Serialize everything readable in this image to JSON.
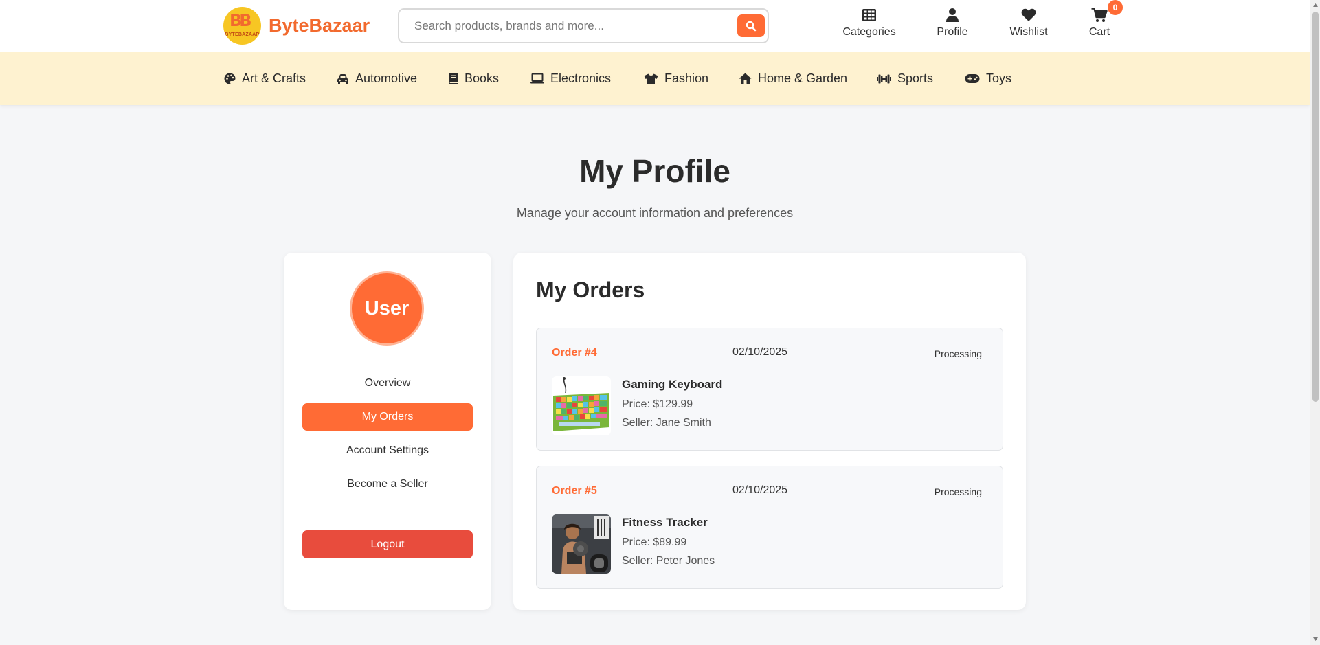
{
  "brand": {
    "name": "ByteBazaar",
    "logo_letters": "BB",
    "logo_small": "BYTEBAZAAR"
  },
  "search": {
    "placeholder": "Search products, brands and more...",
    "value": ""
  },
  "nav": {
    "categories": "Categories",
    "profile": "Profile",
    "wishlist": "Wishlist",
    "cart": "Cart",
    "cart_count": "0"
  },
  "category_bar": [
    {
      "label": "Art & Crafts",
      "icon": "palette-icon"
    },
    {
      "label": "Automotive",
      "icon": "car-icon"
    },
    {
      "label": "Books",
      "icon": "book-icon"
    },
    {
      "label": "Electronics",
      "icon": "laptop-icon"
    },
    {
      "label": "Fashion",
      "icon": "shirt-icon"
    },
    {
      "label": "Home & Garden",
      "icon": "home-icon"
    },
    {
      "label": "Sports",
      "icon": "dumbbell-icon"
    },
    {
      "label": "Toys",
      "icon": "gamepad-icon"
    }
  ],
  "page": {
    "title": "My Profile",
    "subtitle": "Manage your account information and preferences"
  },
  "sidebar": {
    "avatar_text": "User",
    "links": [
      "Overview",
      "My Orders",
      "Account Settings",
      "Become a Seller"
    ],
    "active": "My Orders",
    "logout": "Logout"
  },
  "orders": {
    "title": "My Orders",
    "items": [
      {
        "number": "Order #4",
        "date": "02/10/2025",
        "status": "Processing",
        "product": "Gaming Keyboard",
        "price": "Price: $129.99",
        "seller": "Seller: Jane Smith",
        "thumb": "keyboard-image"
      },
      {
        "number": "Order #5",
        "date": "02/10/2025",
        "status": "Processing",
        "product": "Fitness Tracker",
        "price": "Price: $89.99",
        "seller": "Seller: Peter Jones",
        "thumb": "fitness-image"
      }
    ]
  },
  "colors": {
    "accent": "#ff6b35",
    "logout": "#e84c3d",
    "category_bar": "#fef2d0",
    "logo_bg": "#f7c623"
  }
}
